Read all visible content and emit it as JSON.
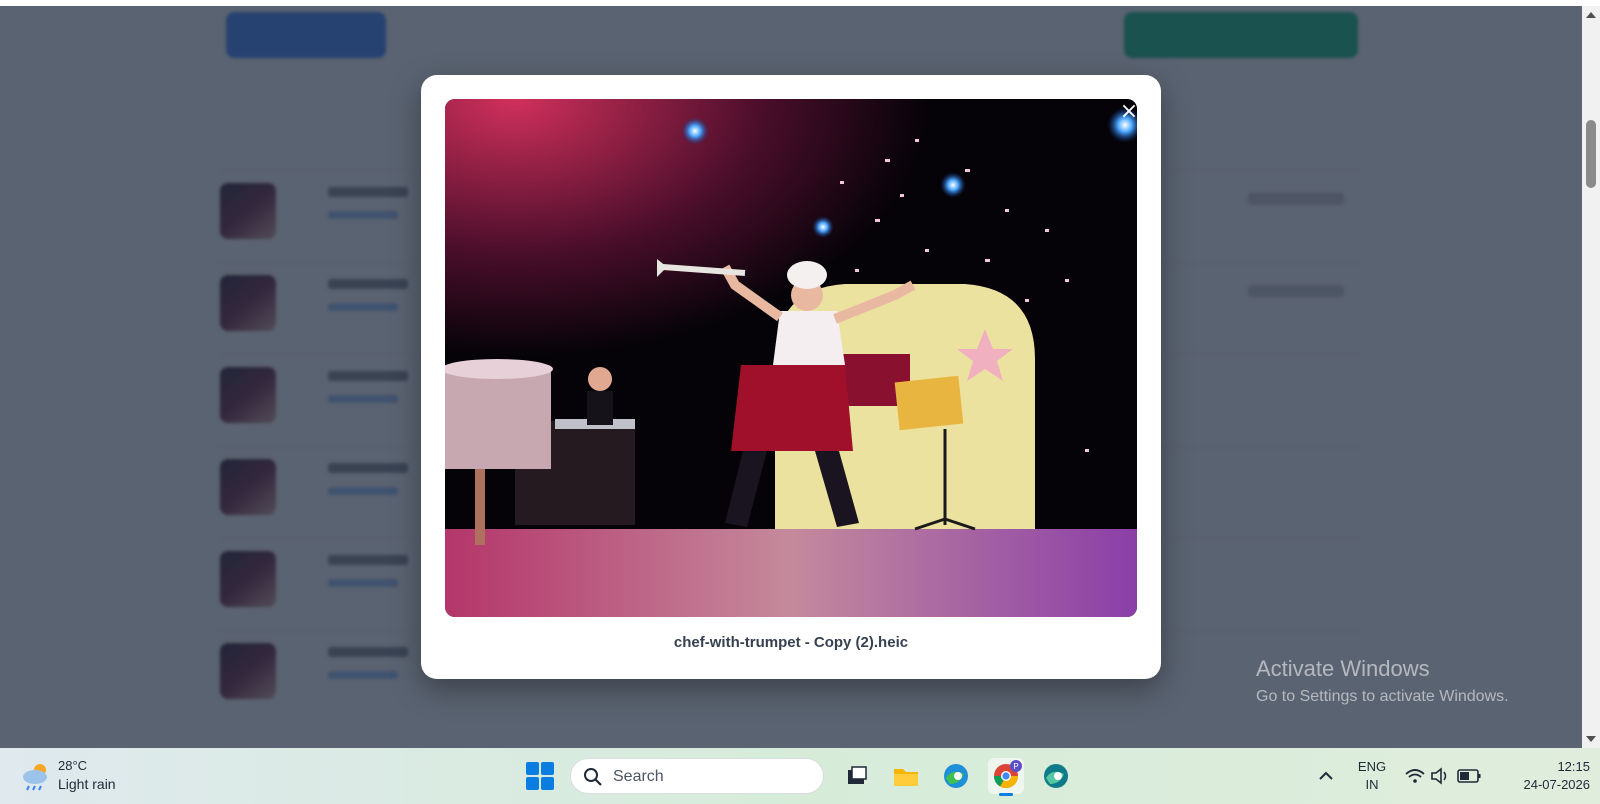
{
  "background_page": {
    "active_tab_label": "",
    "tab_label": "",
    "action_button_label": "",
    "rows_count_visible": 6
  },
  "modal": {
    "caption": "chef-with-trumpet - Copy (2).heic",
    "close_symbol": "×",
    "image_alt": "Chef with trumpet on stage"
  },
  "watermark": {
    "line1": "Activate Windows",
    "line2": "Go to Settings to activate Windows."
  },
  "taskbar": {
    "weather": {
      "temp": "28°C",
      "condition": "Light rain",
      "icon": "cloud-rain-icon"
    },
    "search_placeholder": "Search",
    "apps": [
      {
        "name": "task-view-icon"
      },
      {
        "name": "file-explorer-icon"
      },
      {
        "name": "edge-icon"
      },
      {
        "name": "chrome-icon",
        "badge": "P"
      },
      {
        "name": "edge-beta-icon"
      }
    ],
    "language": {
      "line1": "ENG",
      "line2": "IN"
    },
    "time": "12:15",
    "date": "24-07-2026"
  },
  "colors": {
    "overlay": "#1f293b",
    "accent": "#0a7de0",
    "primary_button": "#3b82f6",
    "green_button": "#10b981"
  }
}
